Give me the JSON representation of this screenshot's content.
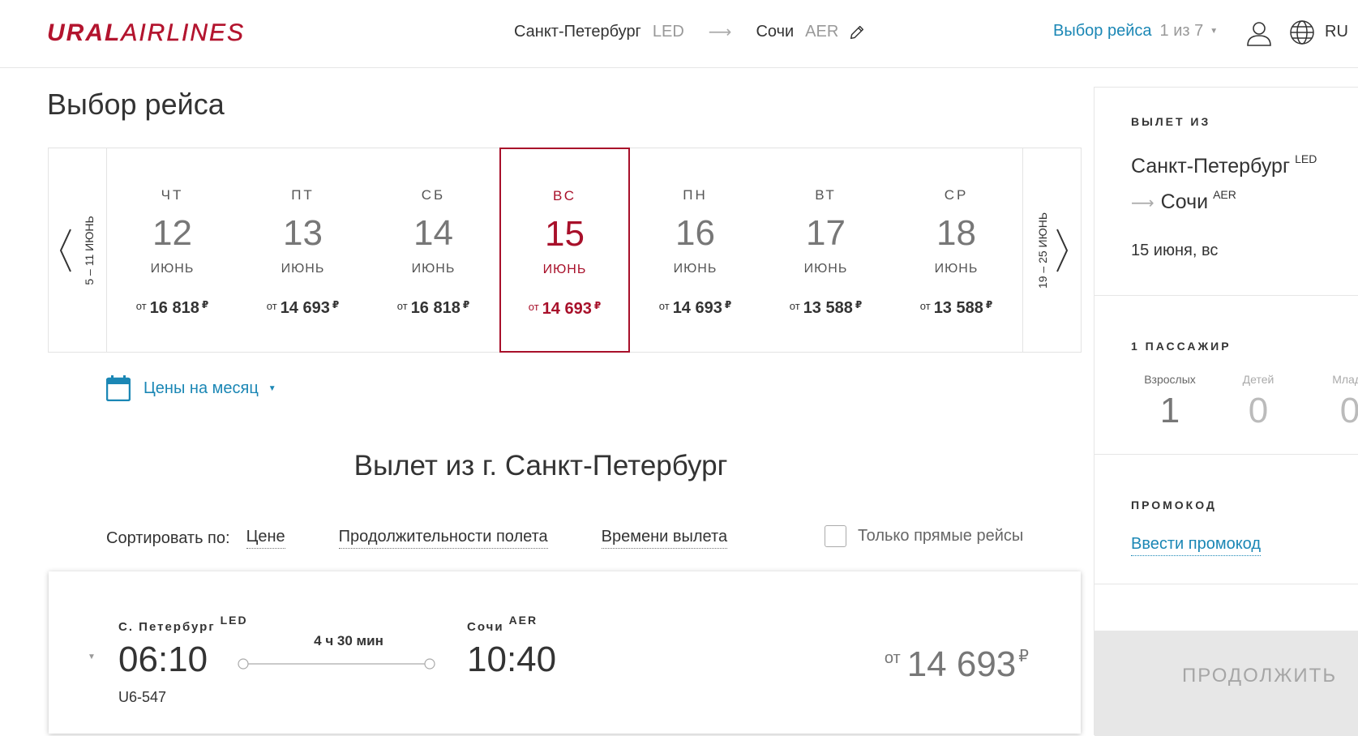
{
  "header": {
    "logo_ural": "URAL",
    "logo_airlines": "AIRLINES",
    "from_city": "Санкт-Петербург",
    "from_code": "LED",
    "to_city": "Сочи",
    "to_code": "AER",
    "step_label": "Выбор рейса",
    "step_count": "1 из 7",
    "lang": "RU"
  },
  "page_title": "Выбор рейса",
  "carousel": {
    "prev_week": "5 – 11 ИЮНЬ",
    "next_week": "19 – 25 ИЮНЬ",
    "price_prefix": "от",
    "currency": "₽",
    "days": [
      {
        "dow": "ЧТ",
        "num": "12",
        "month": "ИЮНЬ",
        "price": "16 818"
      },
      {
        "dow": "ПТ",
        "num": "13",
        "month": "ИЮНЬ",
        "price": "14 693"
      },
      {
        "dow": "СБ",
        "num": "14",
        "month": "ИЮНЬ",
        "price": "16 818"
      },
      {
        "dow": "ВС",
        "num": "15",
        "month": "ИЮНЬ",
        "price": "14 693"
      },
      {
        "dow": "ПН",
        "num": "16",
        "month": "ИЮНЬ",
        "price": "14 693"
      },
      {
        "dow": "ВТ",
        "num": "17",
        "month": "ИЮНЬ",
        "price": "13 588"
      },
      {
        "dow": "СР",
        "num": "18",
        "month": "ИЮНЬ",
        "price": "13 588"
      }
    ],
    "selected_index": 3
  },
  "month_prices_label": "Цены на месяц",
  "section_heading": "Вылет из г. Санкт-Петербург",
  "sort": {
    "label": "Сортировать по:",
    "options": [
      "Цене",
      "Продолжительности полета",
      "Времени вылета"
    ],
    "direct_only_label": "Только прямые рейсы",
    "direct_only_checked": false
  },
  "flight": {
    "dep_city": "С. Петербург",
    "dep_code": "LED",
    "dep_time": "06:10",
    "arr_city": "Сочи",
    "arr_code": "AER",
    "arr_time": "10:40",
    "duration": "4 ч 30 мин",
    "flight_number": "U6-547",
    "price_prefix": "от",
    "price": "14 693",
    "currency": "₽"
  },
  "sidebar": {
    "departure_title": "ВЫЛЕТ ИЗ",
    "dep_city": "Санкт-Петербург",
    "dep_code": "LED",
    "arr_city": "Сочи",
    "arr_code": "AER",
    "date": "15 июня, вс",
    "passengers_title": "1 ПАССАЖИР",
    "passengers": [
      {
        "label": "Взрослых",
        "value": "1"
      },
      {
        "label": "Детей",
        "value": "0"
      },
      {
        "label": "Младе",
        "value": "0"
      }
    ],
    "promo_title": "ПРОМОКОД",
    "promo_link": "Ввести промокод",
    "continue_label": "ПРОДОЛЖИТЬ"
  },
  "colors": {
    "brand_red": "#a8102a",
    "link_blue": "#1b87b5",
    "disabled_gray": "#e7e7e7"
  }
}
